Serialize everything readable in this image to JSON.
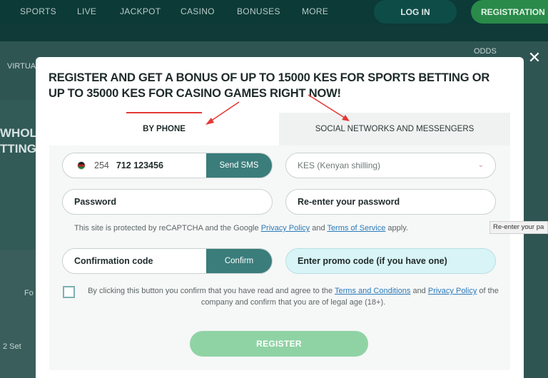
{
  "nav": {
    "items": [
      "SPORTS",
      "LIVE",
      "JACKPOT",
      "CASINO",
      "BONUSES",
      "MORE"
    ],
    "login": "LOG IN",
    "registration": "REGISTRATION"
  },
  "background": {
    "virtual": "VIRTUA",
    "odds": "ODDS",
    "whole": "WHOLE",
    "betting": "TTING",
    "fo": "Fo",
    "set": "2 Set"
  },
  "modal": {
    "title": "REGISTER AND GET A BONUS OF UP TO 15000 KES FOR SPORTS BETTING OR UP TO 35000 KES FOR CASINO GAMES RIGHT NOW!",
    "tabs": {
      "phone": "BY PHONE",
      "social": "SOCIAL NETWORKS AND MESSENGERS"
    },
    "phone": {
      "code": "254",
      "number": "712 123456",
      "send_sms": "Send SMS"
    },
    "currency": "KES (Kenyan shilling)",
    "password_placeholder": "Password",
    "repassword_placeholder": "Re-enter your password",
    "captcha": {
      "prefix": "This site is protected by reCAPTCHA and the Google ",
      "privacy": "Privacy Policy",
      "and": " and ",
      "terms": "Terms of Service",
      "suffix": " apply."
    },
    "tooltip": "Re-enter your pa",
    "confirmation_placeholder": "Confirmation code",
    "confirm_button": "Confirm",
    "promo_placeholder": "Enter promo code (if you have one)",
    "agreement": {
      "prefix": "By clicking this button you confirm that you have read and agree to the ",
      "terms": "Terms and Conditions",
      "and": " and ",
      "privacy": "Privacy Policy",
      "suffix": " of the company and confirm that you are of legal age (18+)."
    },
    "register_button": "REGISTER",
    "close_icon": "close-icon"
  },
  "colors": {
    "accent": "#3a7d7b",
    "register": "#8fd3a4",
    "promo_bg": "#d8f4f6",
    "arrow": "#e53935"
  }
}
